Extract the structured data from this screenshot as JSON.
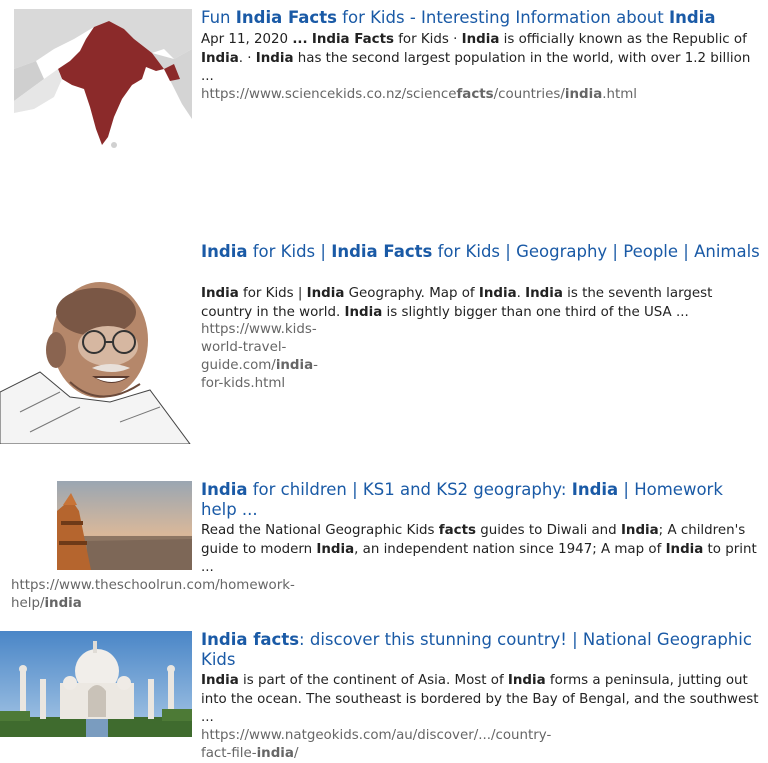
{
  "results": [
    {
      "title": [
        {
          "t": "Fun ",
          "b": false
        },
        {
          "t": "India Facts",
          "b": true
        },
        {
          "t": " for Kids - Interesting Information about ",
          "b": false
        },
        {
          "t": "India",
          "b": true
        }
      ],
      "snippet": [
        {
          "t": "Apr 11, 2020 ",
          "b": false
        },
        {
          "t": "...",
          "b": true
        },
        {
          "t": " ",
          "b": false
        },
        {
          "t": "India Facts",
          "b": true
        },
        {
          "t": " for Kids · ",
          "b": false
        },
        {
          "t": "India",
          "b": true
        },
        {
          "t": " is officially known as the Republic of ",
          "b": false
        },
        {
          "t": "India",
          "b": true
        },
        {
          "t": ". · ",
          "b": false
        },
        {
          "t": "India",
          "b": true
        },
        {
          "t": " has the second largest population in the world, with over 1.2 billion ...",
          "b": false
        }
      ],
      "url": [
        {
          "t": "https://www.sciencekids.co.nz/science",
          "b": false
        },
        {
          "t": "facts",
          "b": true
        },
        {
          "t": "/countries/",
          "b": false
        },
        {
          "t": "india",
          "b": true
        },
        {
          "t": ".html",
          "b": false
        }
      ],
      "image": "india-map-thumbnail"
    },
    {
      "title": [
        {
          "t": "India",
          "b": true
        },
        {
          "t": " for Kids | ",
          "b": false
        },
        {
          "t": "India Facts",
          "b": true
        },
        {
          "t": " for Kids | Geography | People | Animals",
          "b": false
        }
      ],
      "snippet": [
        {
          "t": "India",
          "b": true
        },
        {
          "t": " for Kids | ",
          "b": false
        },
        {
          "t": "India",
          "b": true
        },
        {
          "t": " Geography. Map of ",
          "b": false
        },
        {
          "t": "India",
          "b": true
        },
        {
          "t": ". ",
          "b": false
        },
        {
          "t": "India",
          "b": true
        },
        {
          "t": " is the seventh largest country in the world. ",
          "b": false
        },
        {
          "t": "India",
          "b": true
        },
        {
          "t": " is slightly bigger than one third of the USA ...",
          "b": false
        }
      ],
      "url": [
        {
          "t": "https://www.kids-world-travel-guide.com/",
          "b": false
        },
        {
          "t": "india",
          "b": true
        },
        {
          "t": "-for-kids.html",
          "b": false
        }
      ],
      "image": "gandhi-illustration-thumbnail"
    },
    {
      "title": [
        {
          "t": "India",
          "b": true
        },
        {
          "t": " for children | KS1 and KS2 geography: ",
          "b": false
        },
        {
          "t": "India",
          "b": true
        },
        {
          "t": " | Homework help ...",
          "b": false
        }
      ],
      "snippet": [
        {
          "t": "Read the National Geographic Kids ",
          "b": false
        },
        {
          "t": "facts",
          "b": true
        },
        {
          "t": " guides to Diwali and ",
          "b": false
        },
        {
          "t": "India",
          "b": true
        },
        {
          "t": "; A children's guide to modern ",
          "b": false
        },
        {
          "t": "India",
          "b": true
        },
        {
          "t": ", an independent nation since 1947; A map of ",
          "b": false
        },
        {
          "t": "India",
          "b": true
        },
        {
          "t": " to print  ...",
          "b": false
        }
      ],
      "url": [
        {
          "t": "https://www.theschoolrun.com/homework-help/",
          "b": false
        },
        {
          "t": "india",
          "b": true
        }
      ],
      "image": "city-temple-photo-thumbnail"
    },
    {
      "title": [
        {
          "t": "India facts",
          "b": true
        },
        {
          "t": ": discover this stunning country! | National Geographic Kids",
          "b": false
        }
      ],
      "snippet": [
        {
          "t": "India",
          "b": true
        },
        {
          "t": " is part of the continent of Asia. Most of ",
          "b": false
        },
        {
          "t": "India",
          "b": true
        },
        {
          "t": " forms a peninsula, jutting out into the ocean. The southeast is bordered by the Bay of Bengal, and the southwest ...",
          "b": false
        }
      ],
      "url": [
        {
          "t": "https://www.natgeokids.com/au/discover/.../country-fact-file-",
          "b": false
        },
        {
          "t": "india",
          "b": true
        },
        {
          "t": "/",
          "b": false
        }
      ],
      "image": "taj-mahal-photo-thumbnail"
    }
  ],
  "colors": {
    "link": "#1a5aa6",
    "url": "#666666",
    "text": "#222222",
    "map_land": "#8b2a2a"
  }
}
